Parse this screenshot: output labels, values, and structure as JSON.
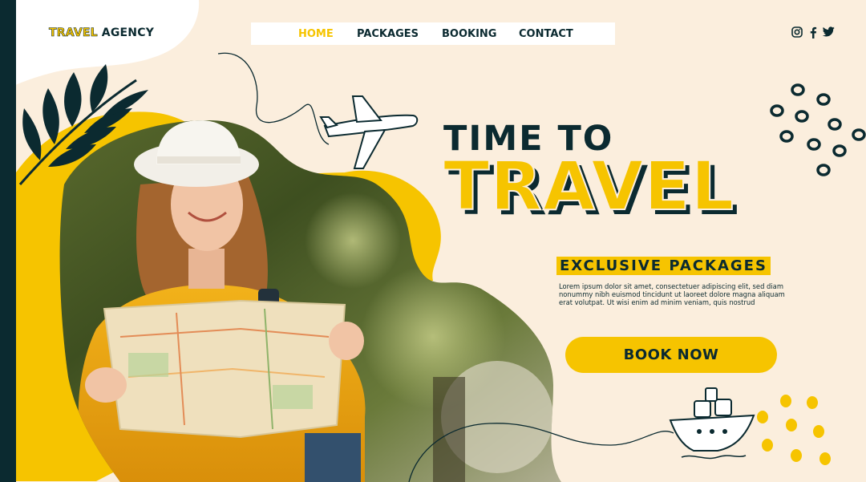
{
  "brand": {
    "part1": "TRAVEL",
    "part2": " AGENCY"
  },
  "nav": {
    "items": [
      "HOME",
      "PACKAGES",
      "BOOKING",
      "CONTACT"
    ],
    "active": "HOME"
  },
  "social": [
    "instagram-icon",
    "facebook-icon",
    "twitter-icon"
  ],
  "hero": {
    "line1": "TIME TO",
    "line2": "TRAVEL",
    "subtitle": "EXCLUSIVE PACKAGES",
    "description": "Lorem ipsum dolor sit amet, consectetuer adipiscing elit, sed diam nonummy nibh euismod tincidunt ut laoreet dolore magna aliquam erat volutpat. Ut wisi enim ad minim veniam, quis nostrud",
    "cta": "BOOK NOW"
  },
  "colors": {
    "accent": "#f6c400",
    "dark": "#0b2a30",
    "background": "#fbeedd"
  }
}
